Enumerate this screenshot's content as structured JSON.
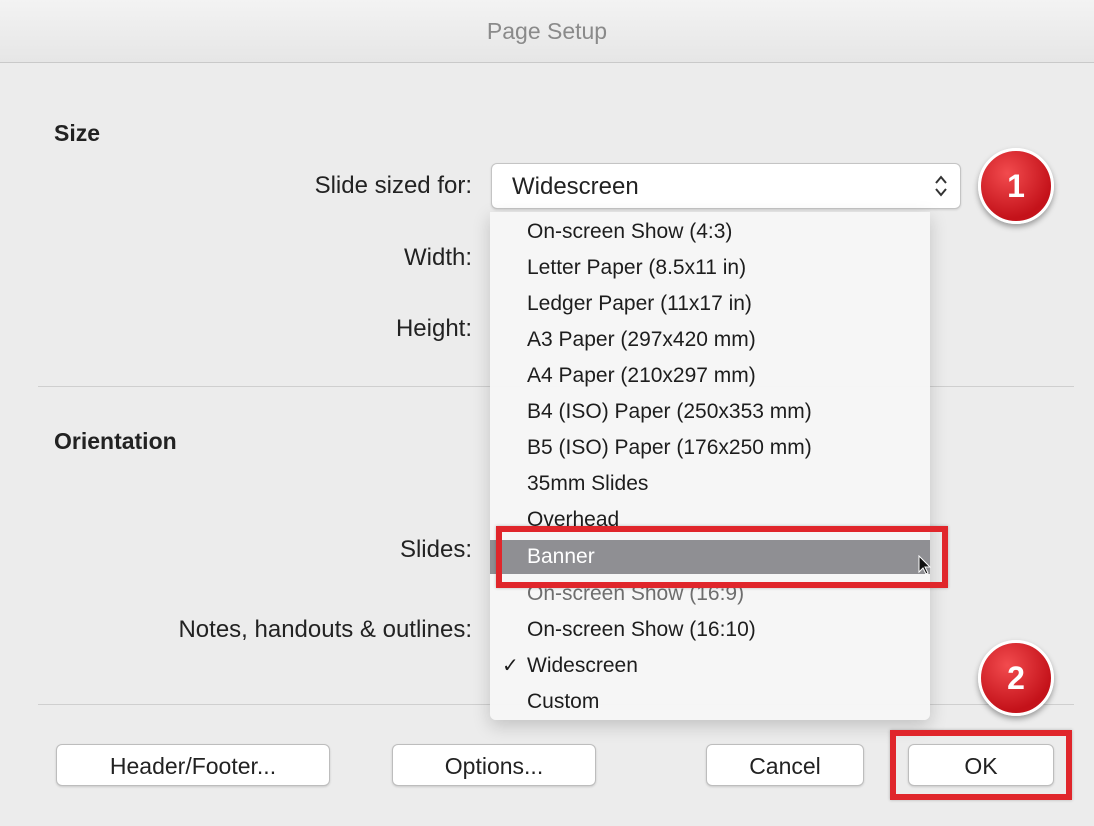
{
  "window": {
    "title": "Page Setup"
  },
  "size_section": {
    "heading": "Size",
    "slide_sized_for_label": "Slide sized for:",
    "selected_value": "Widescreen",
    "width_label": "Width:",
    "height_label": "Height:"
  },
  "orientation_section": {
    "heading": "Orientation",
    "slides_label": "Slides:",
    "notes_label": "Notes, handouts & outlines:"
  },
  "dropdown": {
    "checkmark": "✓",
    "items": [
      {
        "label": "On-screen Show (4:3)"
      },
      {
        "label": "Letter Paper (8.5x11 in)"
      },
      {
        "label": "Ledger Paper (11x17 in)"
      },
      {
        "label": "A3 Paper (297x420 mm)"
      },
      {
        "label": "A4 Paper (210x297 mm)"
      },
      {
        "label": "B4 (ISO) Paper (250x353 mm)"
      },
      {
        "label": "B5 (ISO) Paper (176x250 mm)"
      },
      {
        "label": "35mm Slides"
      },
      {
        "label": "Overhead"
      },
      {
        "label": "Banner"
      },
      {
        "label": "On-screen Show (16:9)"
      },
      {
        "label": "On-screen Show (16:10)"
      },
      {
        "label": "Widescreen"
      },
      {
        "label": "Custom"
      }
    ],
    "highlighted_item": "Banner",
    "checked_item": "Widescreen"
  },
  "buttons": {
    "header_footer": "Header/Footer...",
    "options": "Options...",
    "cancel": "Cancel",
    "ok": "OK"
  },
  "callouts": {
    "step1": "1",
    "step2": "2"
  },
  "colors": {
    "annotation_red": "#e0262b",
    "menu_highlight": "#8f8f93"
  },
  "icons": {
    "select_arrows": "chevron-up-down-icon",
    "checkmark": "checkmark-icon",
    "cursor": "mouse-pointer-icon"
  }
}
